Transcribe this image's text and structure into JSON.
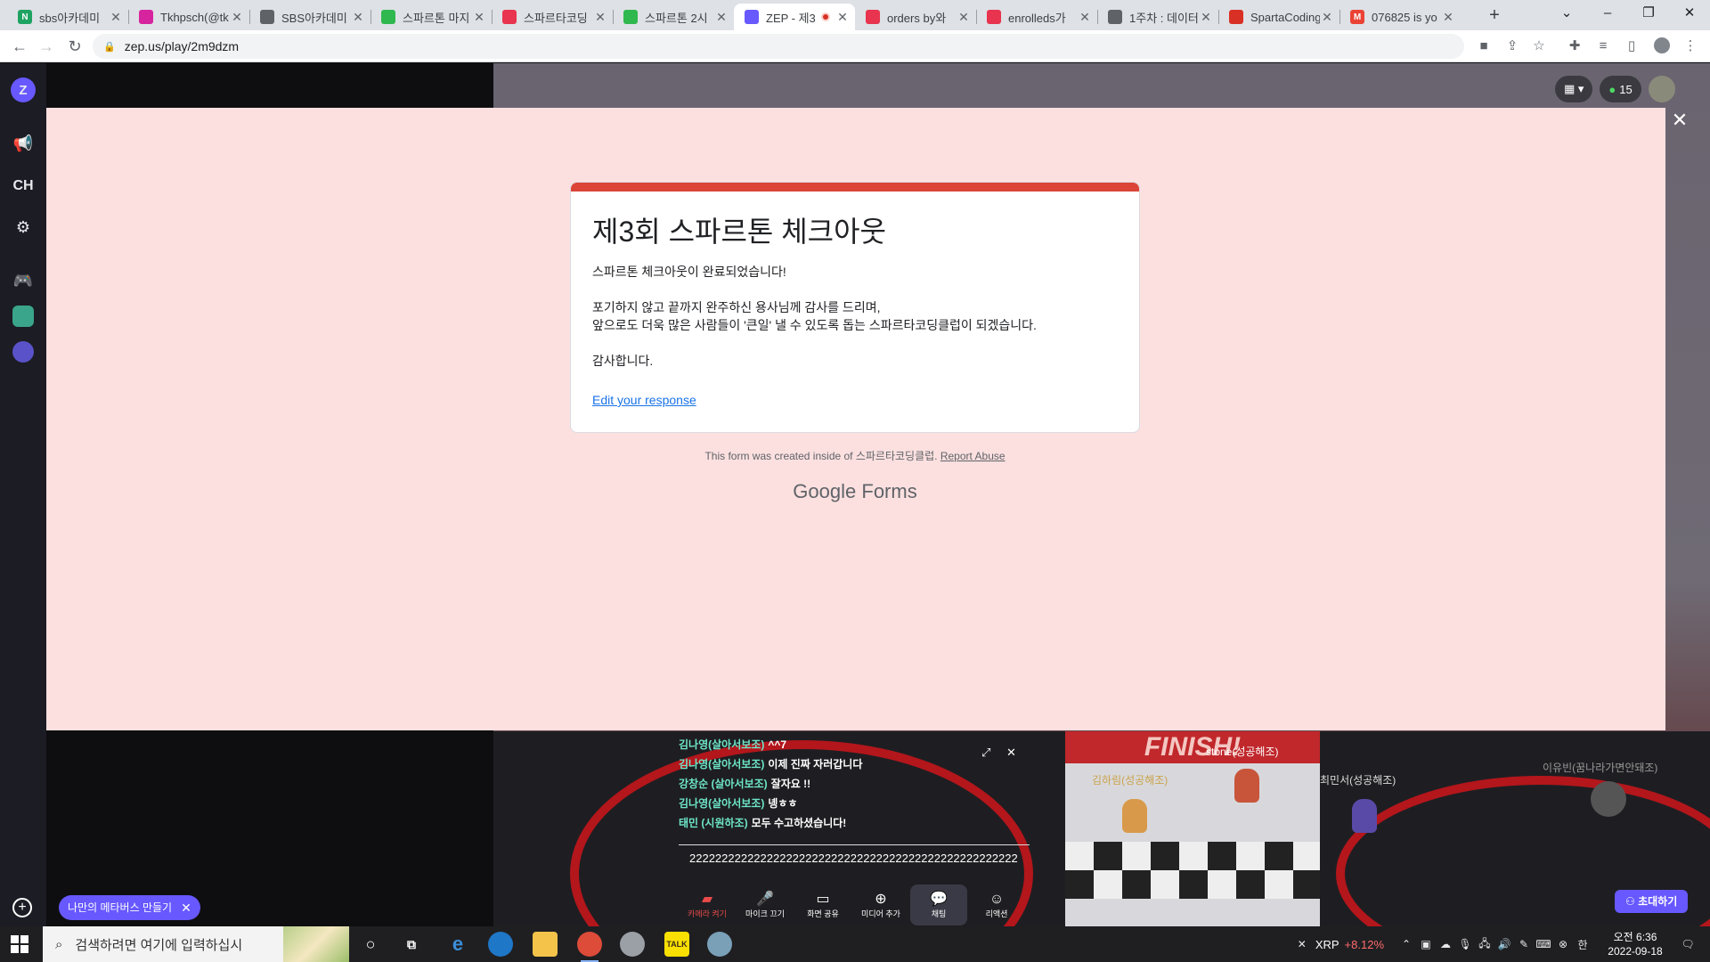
{
  "tabs": [
    {
      "title": "sbs아카데미",
      "fav_color": "#1ea362",
      "fav_letter": "N"
    },
    {
      "title": "Tkhpsch(@tk",
      "fav_color": "#d6249f",
      "fav_letter": ""
    },
    {
      "title": "SBS아카데미",
      "fav_color": "#5f6368",
      "fav_letter": ""
    },
    {
      "title": "스파르톤 마지",
      "fav_color": "#2fb84e",
      "fav_letter": ""
    },
    {
      "title": "스파르타코딩",
      "fav_color": "#e8344e",
      "fav_letter": ""
    },
    {
      "title": "스파르톤 2시",
      "fav_color": "#2fb84e",
      "fav_letter": ""
    },
    {
      "title": "ZEP - 제3",
      "fav_color": "#6758ff",
      "fav_letter": ""
    },
    {
      "title": "orders by와",
      "fav_color": "#e8344e",
      "fav_letter": ""
    },
    {
      "title": "enrolleds가",
      "fav_color": "#e8344e",
      "fav_letter": ""
    },
    {
      "title": "1주차 : 데이터",
      "fav_color": "#5f6368",
      "fav_letter": ""
    },
    {
      "title": "SpartaCoding",
      "fav_color": "#d93025",
      "fav_letter": ""
    },
    {
      "title": "076825 is yo",
      "fav_color": "#ea4335",
      "fav_letter": "M"
    }
  ],
  "address": {
    "url": "zep.us/play/2m9dzm"
  },
  "zep": {
    "sidebar_ch": "CH",
    "participants": "15",
    "finish": "FINISH!",
    "make_metaverse": "나만의 메타버스 만들기",
    "invite": "초대하기",
    "names": [
      "stone(성공해조)",
      "김하림(성공해조)",
      "최민서(성공해조)",
      "이유빈(꿈나라가면안돼조)"
    ],
    "chat": [
      {
        "who": "김나영(살아서보조)",
        "msg": "^^7"
      },
      {
        "who": "김나영(살아서보조)",
        "msg": "이제 진짜 자러갑니다"
      },
      {
        "who": "강창순 (살아서보조)",
        "msg": "잘자요 !!"
      },
      {
        "who": "김나영(살아서보조)",
        "msg": "녱ㅎㅎ"
      },
      {
        "who": "태민 (시원하조)",
        "msg": "모두 수고하셨습니다!"
      }
    ],
    "chat_input": "222222222222222222222222222222222222222222222222222",
    "bottom": [
      {
        "label": "카메라 켜기",
        "icon": "camera-off-icon"
      },
      {
        "label": "마이크 끄기",
        "icon": "mic-icon"
      },
      {
        "label": "화면 공유",
        "icon": "screen-share-icon"
      },
      {
        "label": "미디어 추가",
        "icon": "add-media-icon"
      },
      {
        "label": "채팅",
        "icon": "chat-icon"
      },
      {
        "label": "리액션",
        "icon": "reaction-icon"
      }
    ]
  },
  "form": {
    "title": "제3회 스파르톤 체크아웃",
    "lines": [
      "스파르톤 체크아웃이 완료되었습니다!",
      "",
      "포기하지 않고 끝까지 완주하신 용사님께 감사를 드리며,",
      "앞으로도 더욱 많은 사람들이 '큰일' 낼 수 있도록 돕는 스파르타코딩클럽이 되겠습니다.",
      "",
      "감사합니다."
    ],
    "edit_link": "Edit your response",
    "footer": "This form was created inside of 스파르타코딩클럽.",
    "report": "Report Abuse",
    "brand_google": "Google",
    "brand_forms": "Forms",
    "accent_color": "#db4437"
  },
  "taskbar": {
    "search_placeholder": "검색하려면 여기에 입력하십시",
    "ticker": "XRP",
    "ticker_change": "+8.12%",
    "time": "오전 6:36",
    "date": "2022-09-18"
  }
}
